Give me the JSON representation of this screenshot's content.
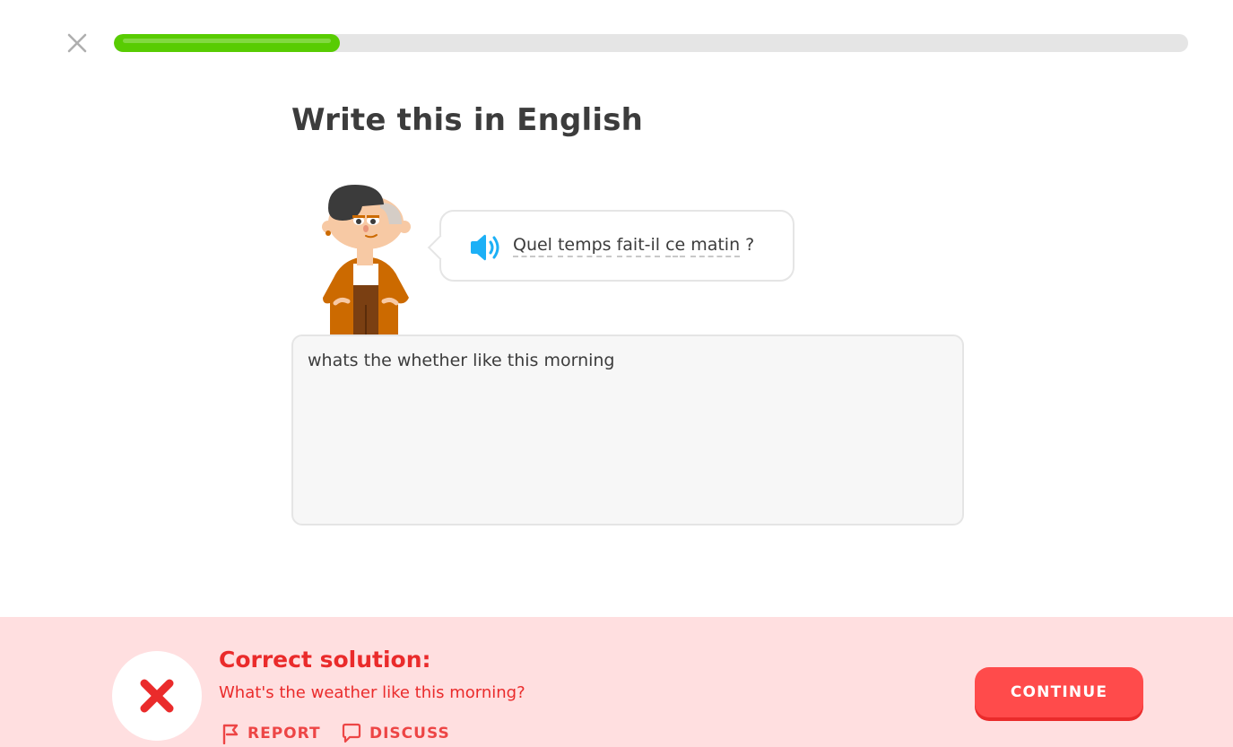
{
  "lesson": {
    "progress_percent": 21
  },
  "challenge": {
    "title": "Write this in English",
    "prompt_words": [
      "Quel",
      "temps",
      "fait-il",
      "ce",
      "matin"
    ],
    "prompt_punctuation": "?",
    "answer": "whats the whether like this morning"
  },
  "feedback": {
    "heading": "Correct solution:",
    "solution": "What's the weather like this morning?",
    "report_label": "REPORT",
    "discuss_label": "DISCUSS",
    "continue_label": "CONTINUE"
  },
  "colors": {
    "progress_green": "#58cc02",
    "error_red": "#ea2b2b",
    "button_red": "#ff4b4b",
    "footer_bg": "#ffdfe0",
    "speaker_blue": "#1cb0f6"
  },
  "icons": {
    "close": "close-icon",
    "speaker": "speaker-icon",
    "result": "x-mark-icon",
    "report": "flag-icon",
    "discuss": "chat-bubble-icon"
  }
}
